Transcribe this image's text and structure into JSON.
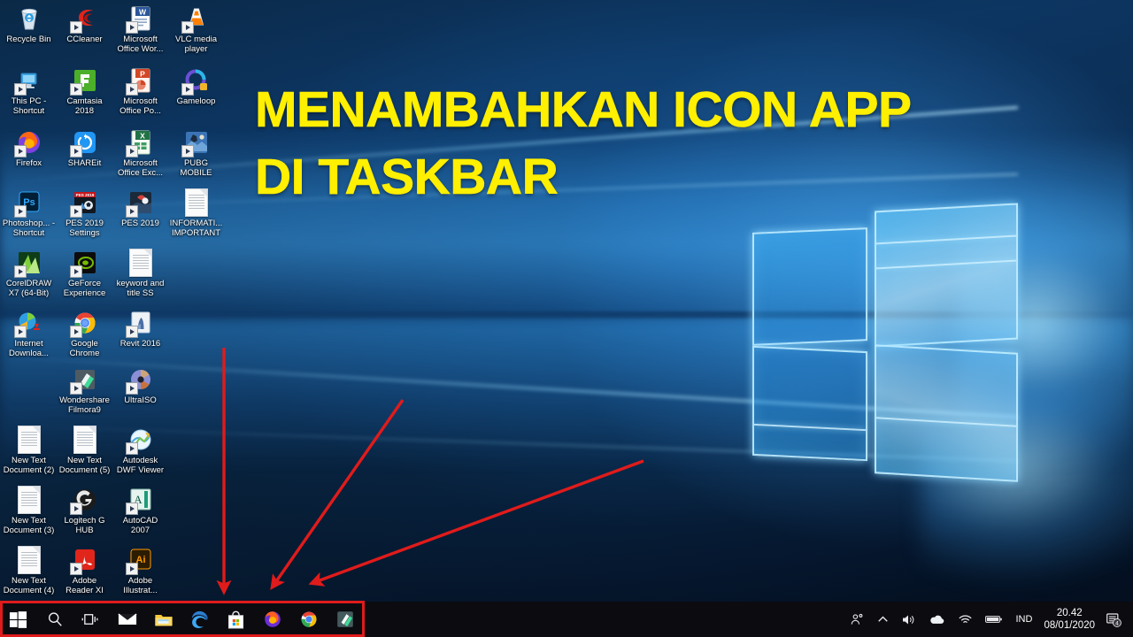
{
  "overlay": {
    "title_line1": "MENAMBAHKAN ICON APP",
    "title_line2": "DI TASKBAR",
    "title_color": "#ffef00",
    "highlight_color": "#e01b1b",
    "arrow_color": "#e01b1b",
    "arrow_count": 3
  },
  "desktop": {
    "icons": [
      {
        "label": "Recycle Bin",
        "icon": "recycle-bin-icon",
        "col": 0,
        "row": 0,
        "shortcut": false
      },
      {
        "label": "CCleaner",
        "icon": "ccleaner-icon",
        "col": 1,
        "row": 0,
        "shortcut": true
      },
      {
        "label": "Microsoft Office Wor...",
        "icon": "microsoft-word-icon",
        "col": 2,
        "row": 0,
        "shortcut": true
      },
      {
        "label": "VLC media player",
        "icon": "vlc-media-player-icon",
        "col": 3,
        "row": 0,
        "shortcut": true
      },
      {
        "label": "This PC - Shortcut",
        "icon": "this-pc-icon",
        "col": 0,
        "row": 1,
        "shortcut": true
      },
      {
        "label": "Camtasia 2018",
        "icon": "camtasia-icon",
        "col": 1,
        "row": 1,
        "shortcut": true
      },
      {
        "label": "Microsoft Office Po...",
        "icon": "microsoft-powerpoint-icon",
        "col": 2,
        "row": 1,
        "shortcut": true
      },
      {
        "label": "Gameloop",
        "icon": "gameloop-icon",
        "col": 3,
        "row": 1,
        "shortcut": true
      },
      {
        "label": "Firefox",
        "icon": "firefox-icon",
        "col": 0,
        "row": 2,
        "shortcut": true
      },
      {
        "label": "SHAREit",
        "icon": "shareit-icon",
        "col": 1,
        "row": 2,
        "shortcut": true
      },
      {
        "label": "Microsoft Office Exc...",
        "icon": "microsoft-excel-icon",
        "col": 2,
        "row": 2,
        "shortcut": true
      },
      {
        "label": "PUBG MOBILE",
        "icon": "pubg-mobile-icon",
        "col": 3,
        "row": 2,
        "shortcut": true
      },
      {
        "label": "Photoshop... - Shortcut",
        "icon": "adobe-photoshop-icon",
        "col": 0,
        "row": 3,
        "shortcut": true
      },
      {
        "label": "PES 2019 Settings",
        "icon": "pes-2019-settings-icon",
        "col": 1,
        "row": 3,
        "shortcut": true
      },
      {
        "label": "PES 2019",
        "icon": "pes-2019-icon",
        "col": 2,
        "row": 3,
        "shortcut": true
      },
      {
        "label": "INFORMATI... IMPORTANT",
        "icon": "text-document-icon",
        "col": 3,
        "row": 3,
        "shortcut": false
      },
      {
        "label": "CorelDRAW X7 (64-Bit)",
        "icon": "coreldraw-icon",
        "col": 0,
        "row": 4,
        "shortcut": true
      },
      {
        "label": "GeForce Experience",
        "icon": "geforce-experience-icon",
        "col": 1,
        "row": 4,
        "shortcut": true
      },
      {
        "label": "keyword and title SS",
        "icon": "text-document-icon",
        "col": 2,
        "row": 4,
        "shortcut": false
      },
      {
        "label": "Internet Downloa...",
        "icon": "internet-download-manager-icon",
        "col": 0,
        "row": 5,
        "shortcut": true
      },
      {
        "label": "Google Chrome",
        "icon": "google-chrome-icon",
        "col": 1,
        "row": 5,
        "shortcut": true
      },
      {
        "label": "Revit 2016",
        "icon": "revit-icon",
        "col": 2,
        "row": 5,
        "shortcut": true
      },
      {
        "label": "Wondershare Filmora9",
        "icon": "filmora-icon",
        "col": 1,
        "row": 6,
        "shortcut": true
      },
      {
        "label": "UltraISO",
        "icon": "ultraiso-icon",
        "col": 2,
        "row": 6,
        "shortcut": true
      },
      {
        "label": "New Text Document (2)",
        "icon": "text-document-icon",
        "col": 0,
        "row": 7,
        "shortcut": false
      },
      {
        "label": "New Text Document (5)",
        "icon": "text-document-icon",
        "col": 1,
        "row": 7,
        "shortcut": false
      },
      {
        "label": "Autodesk DWF Viewer",
        "icon": "autodesk-dwf-viewer-icon",
        "col": 2,
        "row": 7,
        "shortcut": true
      },
      {
        "label": "New Text Document (3)",
        "icon": "text-document-icon",
        "col": 0,
        "row": 8,
        "shortcut": false
      },
      {
        "label": "Logitech G HUB",
        "icon": "logitech-g-hub-icon",
        "col": 1,
        "row": 8,
        "shortcut": true
      },
      {
        "label": "AutoCAD 2007",
        "icon": "autocad-icon",
        "col": 2,
        "row": 8,
        "shortcut": true
      },
      {
        "label": "New Text Document (4)",
        "icon": "text-document-icon",
        "col": 0,
        "row": 9,
        "shortcut": false
      },
      {
        "label": "Adobe Reader XI",
        "icon": "adobe-reader-icon",
        "col": 1,
        "row": 9,
        "shortcut": true
      },
      {
        "label": "Adobe Illustrat...",
        "icon": "adobe-illustrator-icon",
        "col": 2,
        "row": 9,
        "shortcut": true
      }
    ]
  },
  "taskbar": {
    "pinned": [
      {
        "name": "start-button",
        "icon": "windows-start-icon",
        "running": false
      },
      {
        "name": "search-button",
        "icon": "search-icon",
        "running": false
      },
      {
        "name": "task-view-button",
        "icon": "task-view-icon",
        "running": false
      },
      {
        "name": "mail-button",
        "icon": "mail-icon",
        "running": false
      },
      {
        "name": "file-explorer-button",
        "icon": "file-explorer-icon",
        "running": true
      },
      {
        "name": "edge-button",
        "icon": "microsoft-edge-icon",
        "running": false
      },
      {
        "name": "store-button",
        "icon": "microsoft-store-icon",
        "running": true
      },
      {
        "name": "firefox-button",
        "icon": "firefox-icon",
        "running": false
      },
      {
        "name": "chrome-button",
        "icon": "google-chrome-icon",
        "running": true
      },
      {
        "name": "filmora-button",
        "icon": "filmora-icon",
        "running": false
      }
    ],
    "tray": [
      {
        "name": "meet-now-icon",
        "glyph": "people"
      },
      {
        "name": "show-hidden-icons",
        "glyph": "chevron-up"
      },
      {
        "name": "volume-icon",
        "glyph": "speaker"
      },
      {
        "name": "onedrive-icon",
        "glyph": "cloud"
      },
      {
        "name": "network-icon",
        "glyph": "wifi"
      },
      {
        "name": "battery-icon",
        "glyph": "battery"
      }
    ],
    "language": "IND",
    "clock_time": "20.42",
    "clock_date": "08/01/2020",
    "notification_count": "4"
  }
}
